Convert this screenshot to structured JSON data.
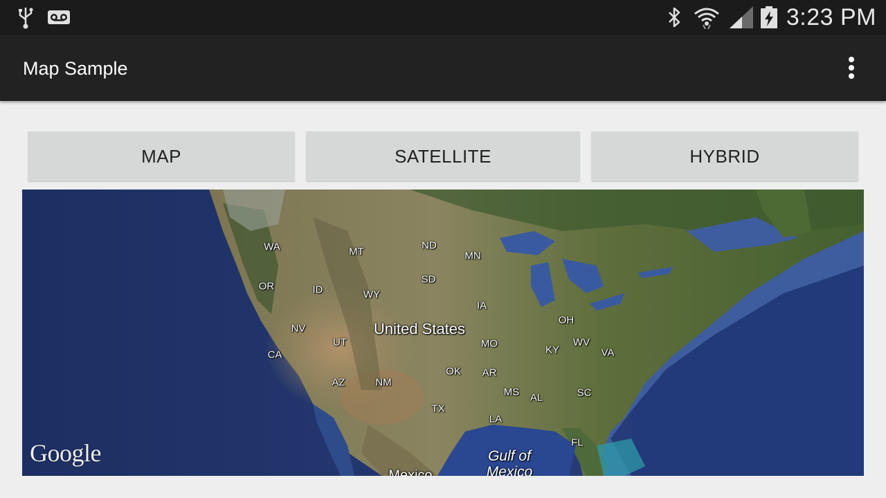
{
  "status_bar": {
    "time": "3:23 PM",
    "left_icons": [
      "usb-icon",
      "voicemail-icon"
    ],
    "right_icons": [
      "bluetooth-icon",
      "wifi-icon",
      "signal-icon",
      "battery-charging-icon"
    ]
  },
  "action_bar": {
    "title": "Map Sample",
    "overflow_icon": "more-vert-icon"
  },
  "map_type_buttons": {
    "map": "MAP",
    "satellite": "SATELLITE",
    "hybrid": "HYBRID"
  },
  "map": {
    "attribution": "Google",
    "country": "United States",
    "water": {
      "gulf_line1": "Gulf of",
      "gulf_line2": "Mexico"
    },
    "mexico": "Mexico",
    "states": {
      "wa": "WA",
      "or": "OR",
      "ca": "CA",
      "nv": "NV",
      "id": "ID",
      "mt": "MT",
      "wy": "WY",
      "ut": "UT",
      "az": "AZ",
      "nm": "NM",
      "nd": "ND",
      "sd": "SD",
      "mn": "MN",
      "ia": "IA",
      "mo": "MO",
      "ok": "OK",
      "ar": "AR",
      "tx": "TX",
      "la": "LA",
      "ms": "MS",
      "al": "AL",
      "oh": "OH",
      "ky": "KY",
      "wv": "WV",
      "va": "VA",
      "sc": "SC",
      "fl": "FL"
    }
  },
  "colors": {
    "status_bar": "#1b1b1b",
    "action_bar": "#222222",
    "background": "#eeeeee",
    "button": "#d6d7d7",
    "ocean": "#24386e",
    "land": "#5b6b3c"
  }
}
